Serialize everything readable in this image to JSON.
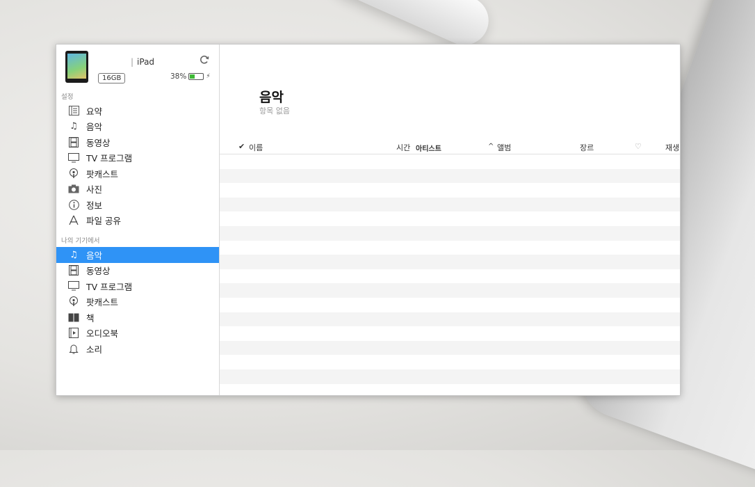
{
  "device": {
    "name": "iPad",
    "capacity": "16GB",
    "battery_percent_label": "38%",
    "battery_level": 0.38
  },
  "sidebar": {
    "settings_label": "설정",
    "settings_items": [
      {
        "label": "요약",
        "icon": "summary-list-icon"
      },
      {
        "label": "음악",
        "icon": "music-note-icon"
      },
      {
        "label": "동영상",
        "icon": "film-icon"
      },
      {
        "label": "TV 프로그램",
        "icon": "tv-icon"
      },
      {
        "label": "팟캐스트",
        "icon": "podcast-icon"
      },
      {
        "label": "사진",
        "icon": "camera-icon"
      },
      {
        "label": "정보",
        "icon": "info-icon"
      },
      {
        "label": "파일 공유",
        "icon": "app-store-icon"
      }
    ],
    "on_device_label": "나의 기기에서",
    "device_items": [
      {
        "label": "음악",
        "icon": "music-note-icon",
        "selected": true
      },
      {
        "label": "동영상",
        "icon": "film-icon"
      },
      {
        "label": "TV 프로그램",
        "icon": "tv-icon"
      },
      {
        "label": "팟캐스트",
        "icon": "podcast-icon"
      },
      {
        "label": "책",
        "icon": "book-icon"
      },
      {
        "label": "오디오북",
        "icon": "audiobook-icon"
      },
      {
        "label": "소리",
        "icon": "bell-icon"
      }
    ]
  },
  "main": {
    "title": "음악",
    "subtitle": "항목 없음",
    "columns": {
      "check": "✔",
      "name": "이름",
      "time": "시간",
      "artist": "아티스트",
      "sort_indicator": "^",
      "album": "앨범",
      "genre": "장르",
      "heart": "♡",
      "plays": "재생"
    }
  },
  "colors": {
    "selection": "#2f93f6",
    "battery": "#3fb836"
  }
}
